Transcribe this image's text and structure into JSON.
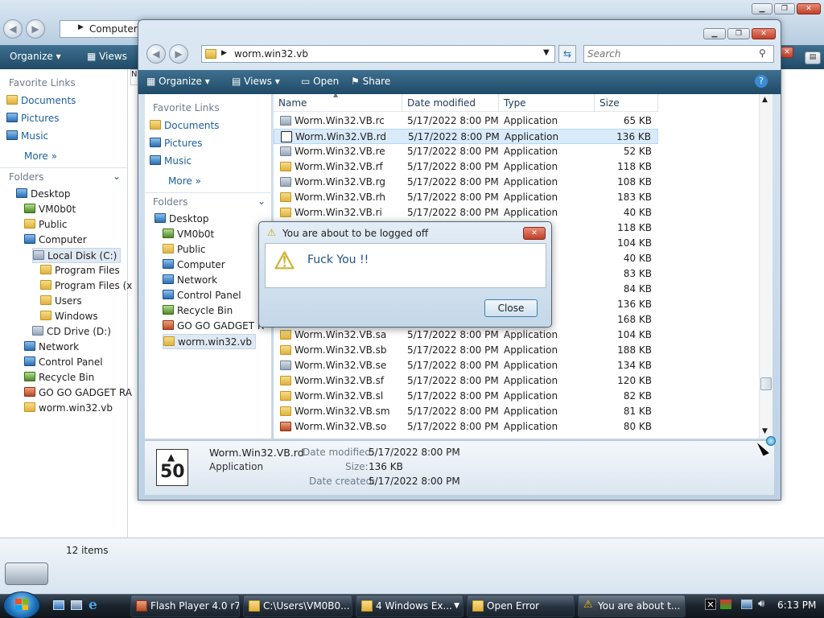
{
  "back_window": {
    "address": "Computer",
    "toolbar": {
      "organize": "Organize",
      "views": "Views"
    },
    "favorite_links_header": "Favorite Links",
    "favorites": [
      {
        "label": "Documents",
        "icon": "documents-icon"
      },
      {
        "label": "Pictures",
        "icon": "pictures-icon"
      },
      {
        "label": "Music",
        "icon": "music-icon"
      }
    ],
    "more_label": "More",
    "folders_header": "Folders",
    "tree": [
      {
        "label": "Desktop",
        "icon": "desktop-icon",
        "indent": 0
      },
      {
        "label": "VM0b0t",
        "icon": "user-icon",
        "indent": 1
      },
      {
        "label": "Public",
        "icon": "folder-icon",
        "indent": 1
      },
      {
        "label": "Computer",
        "icon": "computer-icon",
        "indent": 1
      },
      {
        "label": "Local Disk (C:)",
        "icon": "drive-icon",
        "indent": 2,
        "selected": true
      },
      {
        "label": "Program Files",
        "icon": "folder-icon",
        "indent": 3
      },
      {
        "label": "Program Files (x",
        "icon": "folder-icon",
        "indent": 3
      },
      {
        "label": "Users",
        "icon": "folder-icon",
        "indent": 3
      },
      {
        "label": "Windows",
        "icon": "folder-icon",
        "indent": 3
      },
      {
        "label": "CD Drive (D:)",
        "icon": "cd-drive-icon",
        "indent": 2
      },
      {
        "label": "Network",
        "icon": "network-icon",
        "indent": 1
      },
      {
        "label": "Control Panel",
        "icon": "control-panel-icon",
        "indent": 1
      },
      {
        "label": "Recycle Bin",
        "icon": "recycle-bin-icon",
        "indent": 1
      },
      {
        "label": "GO GO GADGET RA",
        "icon": "program-icon",
        "indent": 1
      },
      {
        "label": "worm.win32.vb",
        "icon": "folder-icon",
        "indent": 1
      }
    ],
    "status_count": "12 items"
  },
  "front_window": {
    "address": "worm.win32.vb",
    "search_placeholder": "Search",
    "toolbar": {
      "organize": "Organize",
      "views": "Views",
      "open": "Open",
      "share": "Share"
    },
    "favorite_links_header": "Favorite Links",
    "favorites": [
      {
        "label": "Documents",
        "icon": "documents-icon"
      },
      {
        "label": "Pictures",
        "icon": "pictures-icon"
      },
      {
        "label": "Music",
        "icon": "music-icon"
      }
    ],
    "more_label": "More",
    "folders_header": "Folders",
    "tree": [
      {
        "label": "Desktop",
        "icon": "desktop-icon",
        "indent": 0
      },
      {
        "label": "VM0b0t",
        "icon": "user-icon",
        "indent": 1
      },
      {
        "label": "Public",
        "icon": "folder-icon",
        "indent": 1
      },
      {
        "label": "Computer",
        "icon": "computer-icon",
        "indent": 1
      },
      {
        "label": "Network",
        "icon": "network-icon",
        "indent": 1
      },
      {
        "label": "Control Panel",
        "icon": "control-panel-icon",
        "indent": 1
      },
      {
        "label": "Recycle Bin",
        "icon": "recycle-bin-icon",
        "indent": 1
      },
      {
        "label": "GO GO GADGET R",
        "icon": "program-icon",
        "indent": 1
      },
      {
        "label": "worm.win32.vb",
        "icon": "folder-icon",
        "indent": 1,
        "selected": true
      }
    ],
    "columns": [
      "Name",
      "Date modified",
      "Type",
      "Size"
    ],
    "files": [
      {
        "name": "Worm.Win32.VB.rc",
        "date": "5/17/2022 8:00 PM",
        "type": "Application",
        "size": "65 KB",
        "icon": "app-icon"
      },
      {
        "name": "Worm.Win32.VB.rd",
        "date": "5/17/2022 8:00 PM",
        "type": "Application",
        "size": "136 KB",
        "icon": "number-50-icon",
        "selected": true
      },
      {
        "name": "Worm.Win32.VB.re",
        "date": "5/17/2022 8:00 PM",
        "type": "Application",
        "size": "52 KB",
        "icon": "app-icon"
      },
      {
        "name": "Worm.Win32.VB.rf",
        "date": "5/17/2022 8:00 PM",
        "type": "Application",
        "size": "118 KB",
        "icon": "folder-icon"
      },
      {
        "name": "Worm.Win32.VB.rg",
        "date": "5/17/2022 8:00 PM",
        "type": "Application",
        "size": "108 KB",
        "icon": "app-icon"
      },
      {
        "name": "Worm.Win32.VB.rh",
        "date": "5/17/2022 8:00 PM",
        "type": "Application",
        "size": "183 KB",
        "icon": "folder-icon"
      },
      {
        "name": "Worm.Win32.VB.ri",
        "date": "5/17/2022 8:00 PM",
        "type": "Application",
        "size": "40 KB",
        "icon": "folder-icon"
      },
      {
        "name": "",
        "date": "",
        "type": "",
        "size": "118 KB",
        "icon": ""
      },
      {
        "name": "",
        "date": "",
        "type": "",
        "size": "104 KB",
        "icon": ""
      },
      {
        "name": "",
        "date": "",
        "type": "",
        "size": "40 KB",
        "icon": ""
      },
      {
        "name": "",
        "date": "",
        "type": "",
        "size": "83 KB",
        "icon": ""
      },
      {
        "name": "",
        "date": "",
        "type": "",
        "size": "84 KB",
        "icon": ""
      },
      {
        "name": "",
        "date": "",
        "type": "",
        "size": "136 KB",
        "icon": ""
      },
      {
        "name": "",
        "date": "",
        "type": "",
        "size": "168 KB",
        "icon": ""
      },
      {
        "name": "Worm.Win32.VB.sa",
        "date": "5/17/2022 8:00 PM",
        "type": "Application",
        "size": "104 KB",
        "icon": "folder-icon"
      },
      {
        "name": "Worm.Win32.VB.sb",
        "date": "5/17/2022 8:00 PM",
        "type": "Application",
        "size": "188 KB",
        "icon": "folder-icon"
      },
      {
        "name": "Worm.Win32.VB.se",
        "date": "5/17/2022 8:00 PM",
        "type": "Application",
        "size": "134 KB",
        "icon": "document-icon"
      },
      {
        "name": "Worm.Win32.VB.sf",
        "date": "5/17/2022 8:00 PM",
        "type": "Application",
        "size": "120 KB",
        "icon": "folder-icon"
      },
      {
        "name": "Worm.Win32.VB.sl",
        "date": "5/17/2022 8:00 PM",
        "type": "Application",
        "size": "82 KB",
        "icon": "folder-icon"
      },
      {
        "name": "Worm.Win32.VB.sm",
        "date": "5/17/2022 8:00 PM",
        "type": "Application",
        "size": "81 KB",
        "icon": "folder-icon"
      },
      {
        "name": "Worm.Win32.VB.so",
        "date": "5/17/2022 8:00 PM",
        "type": "Application",
        "size": "80 KB",
        "icon": "lock-icon"
      }
    ],
    "details": {
      "name": "Worm.Win32.VB.rd",
      "type": "Application",
      "date_modified_label": "Date modified:",
      "date_modified": "5/17/2022 8:00 PM",
      "size_label": "Size:",
      "size": "136 KB",
      "date_created_label": "Date created:",
      "date_created": "5/17/2022 8:00 PM",
      "thumbnail_text": "50"
    }
  },
  "dialog": {
    "title": "You are about to be logged off",
    "message": "Fuck You !!",
    "close_button": "Close",
    "icon": "warning-icon"
  },
  "taskbar": {
    "buttons": [
      {
        "label": "Flash Player 4.0 r7",
        "icon": "flash-icon"
      },
      {
        "label": "C:\\Users\\VM0B0...",
        "icon": "folder-icon"
      },
      {
        "label": "4 Windows Ex...",
        "icon": "folder-icon"
      },
      {
        "label": "Open Error",
        "icon": "folder-icon"
      },
      {
        "label": "You are about t...",
        "icon": "warning-icon"
      }
    ],
    "clock": "6:13 PM"
  },
  "colors": {
    "toolbar": "#2c5a78",
    "selection": "#d9ebfa",
    "taskbar": "#1c2630",
    "link": "#1a5d9e"
  }
}
